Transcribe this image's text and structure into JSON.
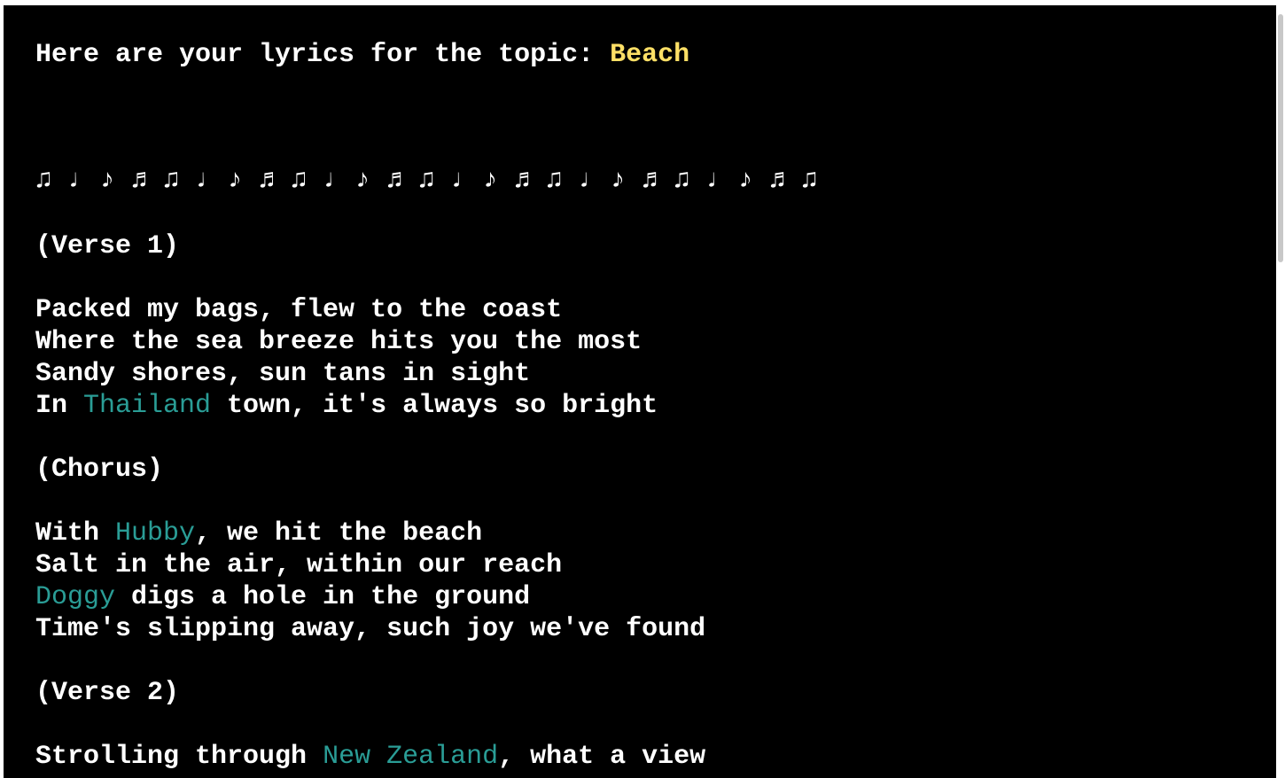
{
  "header": {
    "prefix": "Here are your lyrics for the topic: ",
    "topic": "Beach"
  },
  "notes_line": "♫ ♩ ♪ ♬ ♫ ♩ ♪ ♬ ♫ ♩ ♪ ♬ ♫ ♩ ♪ ♬ ♫ ♩ ♪ ♬ ♫ ♩ ♪ ♬ ♫",
  "colors": {
    "background": "#000000",
    "text": "#ffffff",
    "topic_highlight": "#ffe066",
    "name_highlight": "#2a9d96"
  },
  "lyrics": {
    "verse1_label": "(Verse 1)",
    "v1_l1": "Packed my bags, flew to the coast",
    "v1_l2": "Where the sea breeze hits you the most",
    "v1_l3": "Sandy shores, sun tans in sight",
    "v1_l4_a": "In ",
    "v1_l4_name": "Thailand",
    "v1_l4_b": " town, it's always so bright",
    "chorus_label": "(Chorus)",
    "c_l1_a": "With ",
    "c_l1_name": "Hubby",
    "c_l1_b": ", we hit the beach",
    "c_l2": "Salt in the air, within our reach",
    "c_l3_name": "Doggy",
    "c_l3_b": " digs a hole in the ground",
    "c_l4": "Time's slipping away, such joy we've found",
    "verse2_label": "(Verse 2)",
    "v2_l1_a": "Strolling through ",
    "v2_l1_name": "New Zealand",
    "v2_l1_b": ", what a view"
  }
}
